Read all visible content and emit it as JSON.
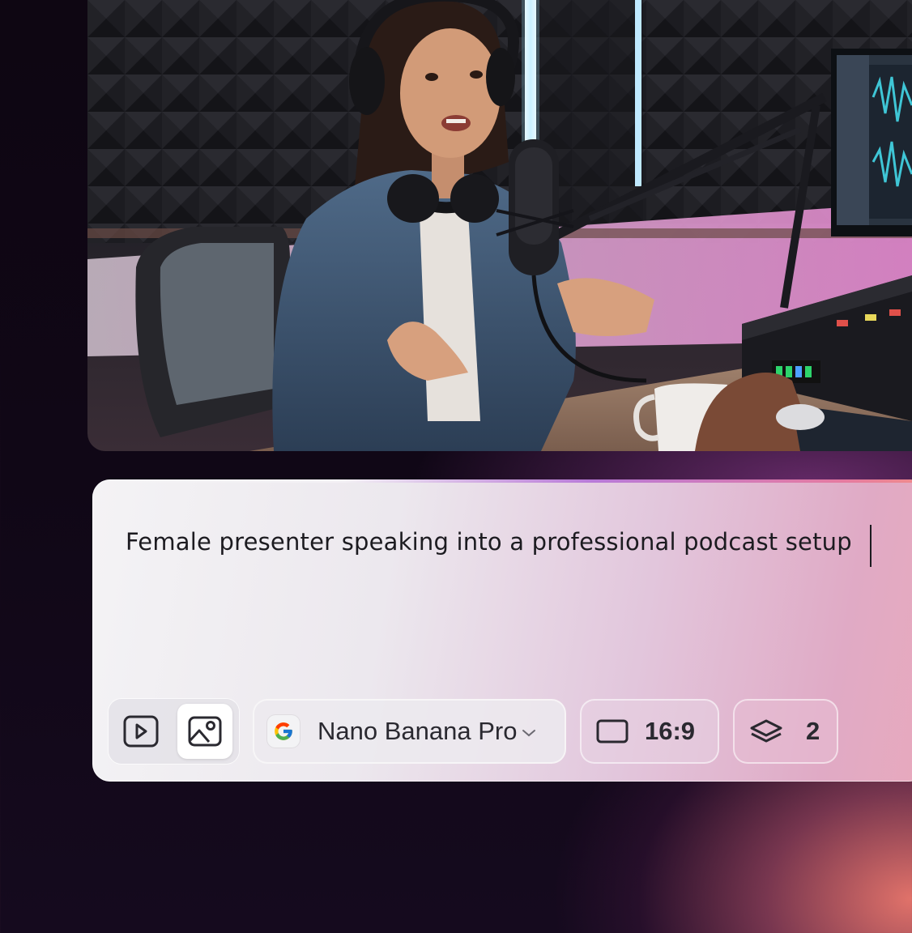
{
  "prompt": {
    "text": "Female presenter speaking into a professional podcast setup"
  },
  "toolbar": {
    "modes": [
      {
        "name": "video",
        "icon": "play-icon",
        "selected": false
      },
      {
        "name": "image",
        "icon": "image-icon",
        "selected": true
      }
    ],
    "model": {
      "label": "Nano Banana Pro",
      "provider_icon": "google-icon"
    },
    "aspect_ratio": {
      "label": "16:9",
      "icon": "rectangle-icon"
    },
    "count": {
      "label": "2",
      "icon": "layers-icon"
    }
  },
  "colors": {
    "background": "#0e0612",
    "card_gradient_start": "#f4f3f5",
    "card_gradient_end": "#e8a9bd",
    "text": "#1c1b20"
  }
}
